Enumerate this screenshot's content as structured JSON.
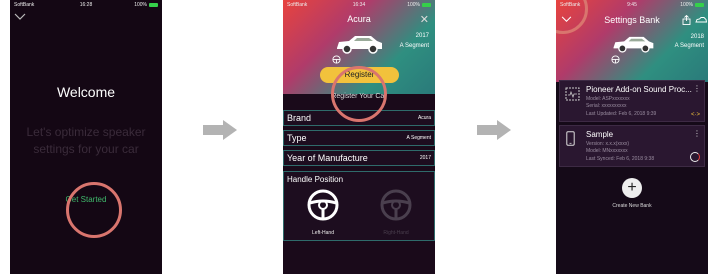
{
  "phone1": {
    "status": {
      "carrier": "SoftBank",
      "time": "16:28",
      "battery": "100%"
    },
    "welcome": "Welcome",
    "subtitle": "Let's optimize speaker settings for your car",
    "get_started": "Get Started"
  },
  "phone2": {
    "status": {
      "carrier": "SoftBank",
      "time": "16:34",
      "battery": "100%"
    },
    "title": "Acura",
    "year": "2017",
    "segment": "A Segment",
    "register_button": "Register",
    "register_sub": "Register Your Car",
    "rows": [
      {
        "label": "Brand",
        "value": "Acura"
      },
      {
        "label": "Type",
        "value": "A Segment"
      },
      {
        "label": "Year of Manufacture",
        "value": "2017"
      }
    ],
    "handle_title": "Handle Position",
    "left_hand": "Left-Hand",
    "right_hand": "Right-Hand"
  },
  "phone3": {
    "status": {
      "carrier": "SoftBank",
      "time": "9:45",
      "battery": "100%"
    },
    "title": "Settings Bank",
    "year": "2018",
    "segment": "A Segment",
    "cards": [
      {
        "title": "Pioneer Add-on Sound Proc...",
        "line1": "Model: ASPxxxxxxx",
        "line2": "Serial: xxxxxxxxxx",
        "line3": "Last Updated: Feb 6, 2018 9:39"
      },
      {
        "title": "Sample",
        "line1": "Version: x.x.x(xxxx)",
        "line2": "Model: MNxxxxxxx",
        "line3": "Last Synced: Feb 6, 2018 9:38"
      }
    ],
    "create_new": "Create New Bank"
  },
  "colors": {
    "accent_yellow": "#f2c23c",
    "highlight_ring": "#d9756e",
    "start_green": "#3fb86b",
    "arrow_gray": "#b3b3b3"
  }
}
